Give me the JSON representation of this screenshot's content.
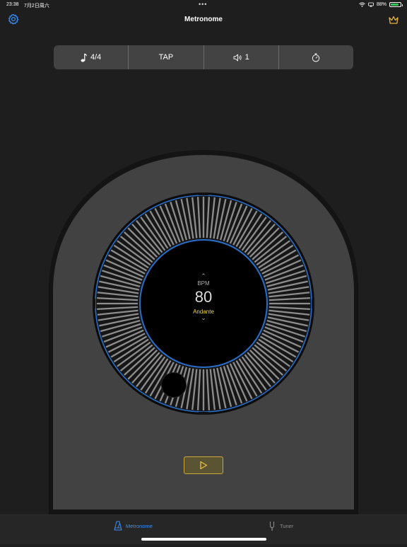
{
  "status_bar": {
    "time": "23:38",
    "date": "7月2日周六",
    "multitask_dots": "•••",
    "battery_percent": "88%",
    "battery_level": 0.88,
    "icons": [
      "wifi-icon",
      "screen-mirror-icon",
      "battery-icon"
    ]
  },
  "nav": {
    "title": "Metronome",
    "left_icon": "gear-icon",
    "right_icon": "crown-icon"
  },
  "toolbar": {
    "time_signature": "4/4",
    "tap_label": "TAP",
    "volume_label": "1",
    "icons": [
      "music-note-icon",
      "speaker-icon",
      "timer-icon"
    ]
  },
  "dial": {
    "bpm_label": "BPM",
    "bpm_value": "80",
    "tempo_name": "Andante",
    "up_symbol": "⌃",
    "down_symbol": "⌄"
  },
  "play_button": {
    "icon": "play-icon"
  },
  "tabs": [
    {
      "label": "Metronome",
      "icon": "metronome-icon",
      "selected": true
    },
    {
      "label": "Tuner",
      "icon": "tuning-fork-icon",
      "selected": false
    }
  ],
  "colors": {
    "background": "#1e1e1e",
    "housing": "#424242",
    "accent_blue": "#3d8ef0",
    "tempo_yellow": "#f0d64a",
    "play_border": "#c9a73a",
    "battery_green": "#34c759"
  }
}
